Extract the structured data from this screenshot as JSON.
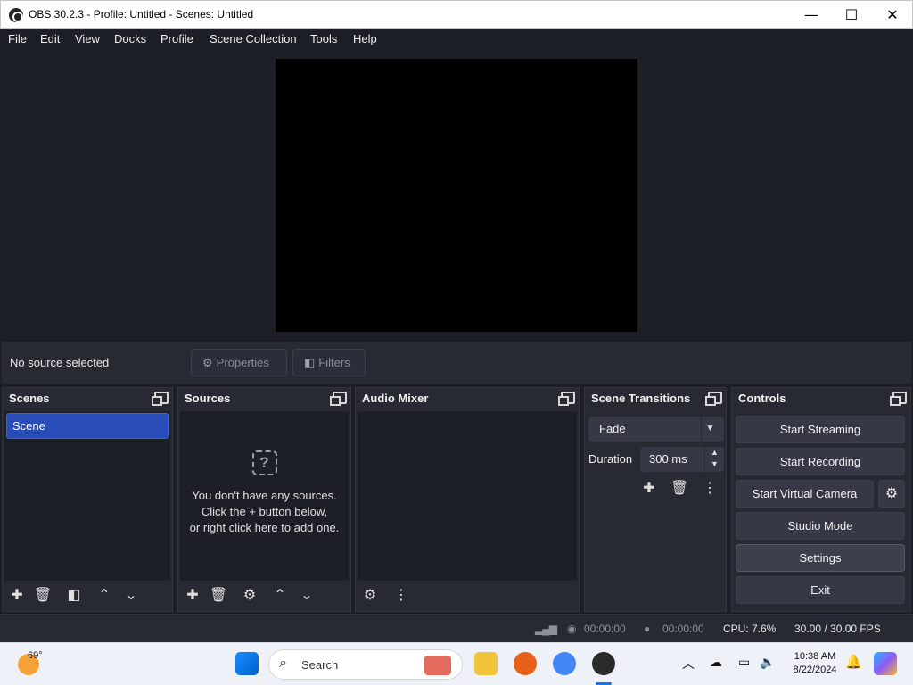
{
  "window": {
    "title": "OBS 30.2.3 - Profile: Untitled - Scenes: Untitled",
    "minimize": "—",
    "maximize": "☐",
    "close": "✕"
  },
  "menu": [
    "File",
    "Edit",
    "View",
    "Docks",
    "Profile",
    "Scene Collection",
    "Tools",
    "Help"
  ],
  "source_toolbar": {
    "status": "No source selected",
    "properties_label": "Properties",
    "filters_label": "Filters"
  },
  "docks": {
    "scenes": {
      "title": "Scenes",
      "items": [
        "Scene"
      ]
    },
    "sources": {
      "title": "Sources",
      "empty_line1": "You don't have any sources.",
      "empty_line2": "Click the + button below,",
      "empty_line3": "or right click here to add one."
    },
    "audio_mixer": {
      "title": "Audio Mixer"
    },
    "scene_transitions": {
      "title": "Scene Transitions",
      "transition": "Fade",
      "duration_label": "Duration",
      "duration_value": "300 ms"
    },
    "controls": {
      "title": "Controls",
      "start_streaming": "Start Streaming",
      "start_recording": "Start Recording",
      "start_virtual_camera": "Start Virtual Camera",
      "studio_mode": "Studio Mode",
      "settings": "Settings",
      "exit": "Exit"
    }
  },
  "status_bar": {
    "stream_time": "00:00:00",
    "record_time": "00:00:00",
    "cpu": "CPU: 7.6%",
    "fps": "30.00 / 30.00 FPS"
  },
  "taskbar": {
    "weather_temp": "69°",
    "search_placeholder": "Search",
    "time": "10:38 AM",
    "date": "8/22/2024"
  }
}
